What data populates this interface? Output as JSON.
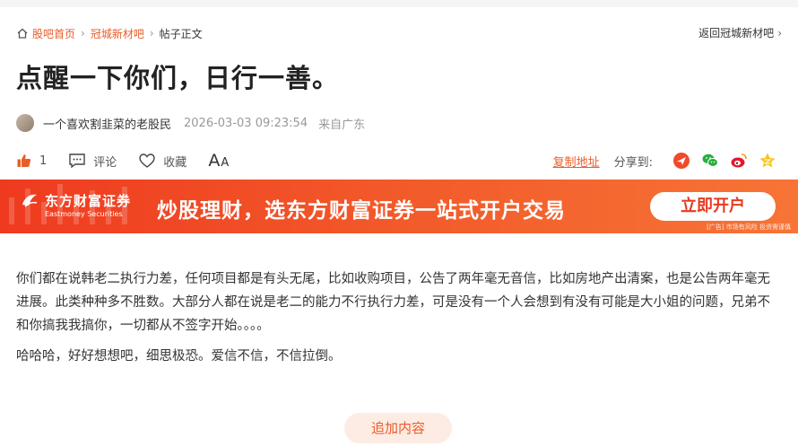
{
  "breadcrumb": {
    "home": "股吧首页",
    "forum": "冠城新材吧",
    "current": "帖子正文",
    "back": "返回冠城新材吧"
  },
  "post": {
    "title": "点醒一下你们，日行一善。",
    "author": "一个喜欢割韭菜的老股民",
    "time": "2026-03-03 09:23:54",
    "from": "来自广东",
    "paragraphs": [
      "你们都在说韩老二执行力差，任何项目都是有头无尾，比如收购项目，公告了两年毫无音信，比如房地产出清案，也是公告两年毫无进展。此类种种多不胜数。大部分人都在说是老二的能力不行执行力差，可是没有一个人会想到有没有可能是大小姐的问题，兄弟不和你搞我我搞你，一切都从不签字开始。。。。",
      "哈哈哈，好好想想吧，细思极恐。爱信不信，不信拉倒。"
    ]
  },
  "actions": {
    "like_count": "1",
    "comment": "评论",
    "favorite": "收藏",
    "font_big": "A",
    "font_small": "A",
    "copy_link": "复制地址",
    "share_label": "分享到:"
  },
  "banner": {
    "brand_cn": "东方财富证券",
    "brand_en": "Eastmoney Securities",
    "slogan": "炒股理财，选东方财富证券一站式开户交易",
    "button": "立即开户",
    "risk_note": "[广告] 市场有风险 投资需谨慎"
  },
  "add_content": "追加内容",
  "colors": {
    "accent": "#e85d2a",
    "banner": "#f04a24"
  },
  "icons": [
    "home-icon",
    "thumb-up-icon",
    "comment-icon",
    "heart-icon",
    "font-size-icon",
    "toutiao-icon",
    "wechat-icon",
    "weibo-icon",
    "qzone-icon"
  ]
}
